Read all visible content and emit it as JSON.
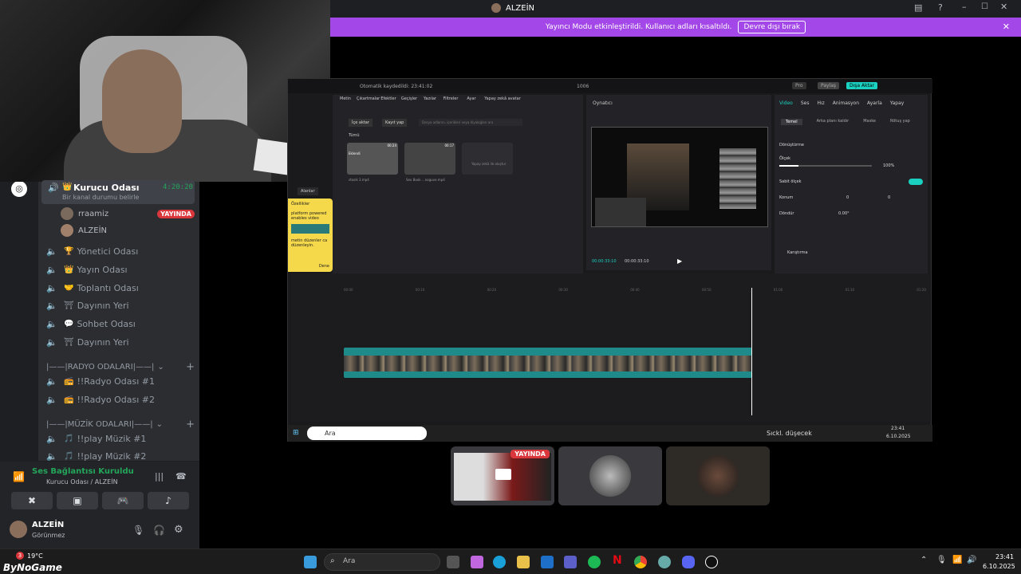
{
  "titlebar": {
    "username": "ALZEİN"
  },
  "banner": {
    "message": "Yayıncı Modu etkinleştirildi. Kullanıcı adları kısaltıldı.",
    "button": "Devre dışı bırak"
  },
  "channels": {
    "active": {
      "name": "Kurucu Odası",
      "timer": "4:20:20",
      "status": "Bir kanal durumu belirle"
    },
    "users": [
      {
        "name": "rraamiz",
        "badge": "YAYINDA"
      },
      {
        "name": "ALZEİN"
      }
    ],
    "voice": [
      {
        "name": "Yönetici Odası",
        "emoji": "🏆"
      },
      {
        "name": "Yayın Odası",
        "emoji": "👑"
      },
      {
        "name": "Toplantı Odası",
        "emoji": "🤝"
      },
      {
        "name": "Dayının Yeri",
        "emoji": "⛩"
      },
      {
        "name": "Sohbet Odası",
        "emoji": "💬"
      },
      {
        "name": "Dayının Yeri",
        "emoji": "⛩"
      }
    ],
    "cat_radio": "|——|RADYO ODALARI|——|",
    "radio": [
      "!!Radyo Odası #1",
      "!!Radyo Odası #2"
    ],
    "cat_music": "|——|MÜZİK ODALARI|——|",
    "music": [
      "!!play Müzik #1",
      "!!play Müzik #2"
    ]
  },
  "voicepanel": {
    "status": "Ses Bağlantısı Kuruldu",
    "location": "Kurucu Odası / ALZEİN"
  },
  "user": {
    "name": "ALZEİN",
    "status": "Görünmez"
  },
  "capcut": {
    "autosave": "Otomatik kaydedildi: 23:41:02",
    "project": "1006",
    "pro": "Pro",
    "share": "Paylaş",
    "export": "Dışa Aktar",
    "tools": [
      "Metin",
      "Çıkartmalar",
      "Efektler",
      "Geçişler",
      "Yazılar",
      "Filtreler",
      "Ayar",
      "Yapay zekâ avatar"
    ],
    "import": "İçe aktar",
    "record": "Kayıt yap",
    "search_placeholder": "Dosya adlarını, içerikleri veya diyaloğları ara",
    "all": "Tümü",
    "clips": [
      {
        "label": "Eklendi",
        "duration": "00:24",
        "name": "stoxlk 3.mp4"
      },
      {
        "duration": "00:17",
        "name": "Sex Book ...noguve.mp4"
      },
      {
        "name": "Yapay zekâ ile oluştur"
      }
    ],
    "player_label": "Oynatıcı",
    "time_current": "00:00:33:10",
    "time_total": "00:00:33:10",
    "right_tabs": [
      "Video",
      "Ses",
      "Hız",
      "Animasyon",
      "Ayarla",
      "Yapay"
    ],
    "sub_tabs": [
      "Temel",
      "Arka planı kaldır",
      "Maske",
      "Rötuş yap"
    ],
    "transform": "Dönüştürme",
    "scale_label": "Ölçek",
    "scale_value": "100%",
    "uniform": "Sabit ölçek",
    "position": "Konum",
    "x": "0",
    "y": "0",
    "rotate": "Döndür",
    "rotate_value": "0.00°",
    "blend": "Karıştırma",
    "sidebar_label": "Alanlar",
    "tooltip_title": "Özellikler",
    "tooltip_body": "platform powered enables video",
    "tooltip_foot": "metin düzenler ca düzenleyin.",
    "tooltip_btn": "Dene",
    "ruler": [
      "00:00",
      "00:10",
      "00:20",
      "00:30",
      "00:40",
      "00:50",
      "01:00",
      "01:10",
      "01:20"
    ]
  },
  "inner_taskbar": {
    "search": "Ara",
    "weather": "Sıckl. düşecek",
    "time": "23:41",
    "date": "6.10.2025"
  },
  "tiles": {
    "live_badge": "YAYINDA"
  },
  "taskbar": {
    "temp": "19°C",
    "brand": "ByNoGame",
    "search": "Ara",
    "time": "23:41",
    "date": "6.10.2025",
    "notif": "3"
  }
}
